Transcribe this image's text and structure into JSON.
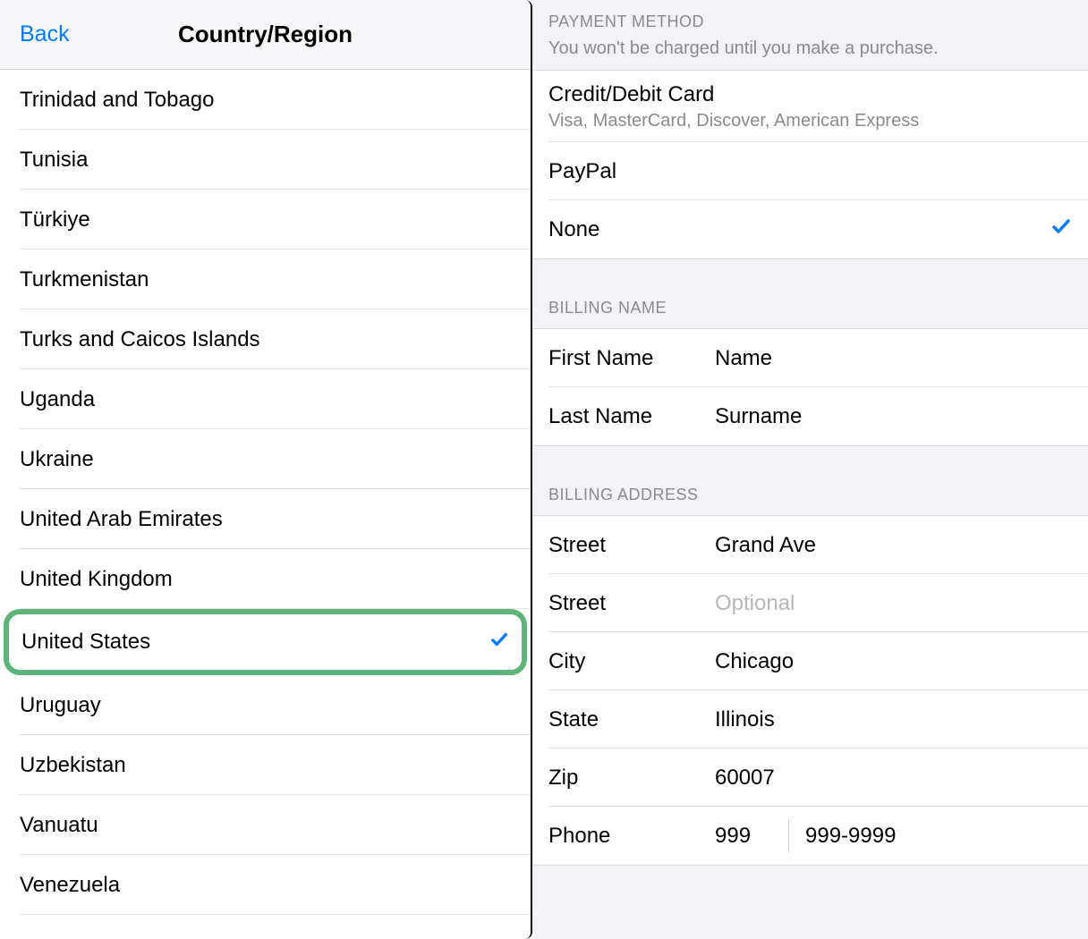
{
  "left": {
    "back_label": "Back",
    "title": "Country/Region",
    "countries": [
      {
        "name": "Trinidad and Tobago",
        "selected": false
      },
      {
        "name": "Tunisia",
        "selected": false
      },
      {
        "name": "Türkiye",
        "selected": false
      },
      {
        "name": "Turkmenistan",
        "selected": false
      },
      {
        "name": "Turks and Caicos Islands",
        "selected": false
      },
      {
        "name": "Uganda",
        "selected": false
      },
      {
        "name": "Ukraine",
        "selected": false
      },
      {
        "name": "United Arab Emirates",
        "selected": false
      },
      {
        "name": "United Kingdom",
        "selected": false
      },
      {
        "name": "United States",
        "selected": true,
        "highlight": true
      },
      {
        "name": "Uruguay",
        "selected": false
      },
      {
        "name": "Uzbekistan",
        "selected": false
      },
      {
        "name": "Vanuatu",
        "selected": false
      },
      {
        "name": "Venezuela",
        "selected": false
      }
    ]
  },
  "right": {
    "payment_method": {
      "header": "PAYMENT METHOD",
      "note": "You won't be charged until you make a purchase.",
      "options": [
        {
          "label": "Credit/Debit Card",
          "sub": "Visa, MasterCard, Discover, American Express",
          "selected": false
        },
        {
          "label": "PayPal",
          "selected": false
        },
        {
          "label": "None",
          "selected": true
        }
      ]
    },
    "billing_name": {
      "header": "BILLING NAME",
      "fields": [
        {
          "label": "First Name",
          "value": "Name"
        },
        {
          "label": "Last Name",
          "value": "Surname"
        }
      ]
    },
    "billing_address": {
      "header": "BILLING ADDRESS",
      "fields": [
        {
          "label": "Street",
          "value": "Grand Ave"
        },
        {
          "label": "Street",
          "placeholder": "Optional",
          "is_placeholder": true
        },
        {
          "label": "City",
          "value": "Chicago"
        },
        {
          "label": "State",
          "value": "Illinois"
        },
        {
          "label": "Zip",
          "value": "60007"
        }
      ],
      "phone": {
        "label": "Phone",
        "area": "999",
        "number": "999-9999"
      }
    }
  }
}
